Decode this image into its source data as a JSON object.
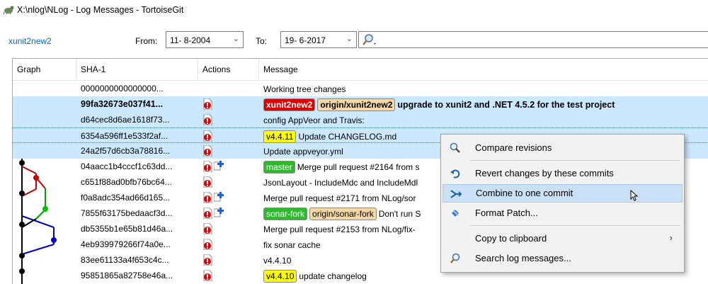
{
  "window": {
    "title": "X:\\nlog\\NLog - Log Messages - TortoiseGit"
  },
  "toolbar": {
    "branch": "xunit2new2",
    "from_label": "From:",
    "from_value": "11- 8-2004",
    "to_label": "To:",
    "to_value": "19- 6-2017"
  },
  "columns": [
    "Graph",
    "SHA-1",
    "Actions",
    "Message"
  ],
  "commits": [
    {
      "sha": "0000000000000000...",
      "message": "Working tree changes"
    },
    {
      "sha": "99fa32673e037f41...",
      "tags": [
        "xunit2new2",
        "origin/xunit2new2"
      ],
      "message": "upgrade to xunit2 and .NET 4.5.2 for the test project"
    },
    {
      "sha": "d64cec8d6ae1618f73...",
      "message": "config AppVeor and Travis:"
    },
    {
      "sha": "6354a596ff1e533f2af...",
      "tags": [
        "v4.4.11"
      ],
      "message": "Update CHANGELOG.md"
    },
    {
      "sha": "24a2f57d6cb3a78816...",
      "message": "Update appveyor.yml"
    },
    {
      "sha": "04aacc1b4cccf1c63dd...",
      "tags": [
        "master"
      ],
      "message": "Merge pull request #2164 from s"
    },
    {
      "sha": "c651f88ad0bfb76bc64...",
      "message": "JsonLayout - IncludeMdc and IncludeMdl"
    },
    {
      "sha": "f0a8adc354ad66d165...",
      "message": "Merge pull request #2171 from NLog/sor"
    },
    {
      "sha": "7855f63175bedaacf3d...",
      "tags": [
        "sonar-fork",
        "origin/sonar-fork"
      ],
      "message": "Don't run S"
    },
    {
      "sha": "db5355b1e65b81d46a...",
      "message": "Merge pull request #2153 from NLog/fix-"
    },
    {
      "sha": "4eb939979266f74a0e...",
      "message": "fix sonar cache"
    },
    {
      "sha": "83ee61133a4f653c4c...",
      "message": "v4.4.10"
    },
    {
      "sha": "95851865a82758e46a...",
      "tags": [
        "v4.4.10"
      ],
      "message": "update changelog"
    }
  ],
  "context_menu": {
    "items": [
      {
        "label": "Compare revisions",
        "icon": "magnifier-compare-icon"
      },
      {
        "label": "Revert changes by these commits",
        "icon": "revert-arrow-icon"
      },
      {
        "label": "Combine to one commit",
        "icon": "combine-arrows-icon"
      },
      {
        "label": "Format Patch...",
        "icon": "patch-icon"
      },
      {
        "label": "Copy to clipboard",
        "icon": "chevron-right-icon"
      },
      {
        "label": "Search log messages...",
        "icon": "search-icon"
      }
    ],
    "submenu_arrow": "›"
  },
  "colors": {
    "selection": "#cce8ff",
    "menu_highlight": "#c9e0f7",
    "link": "#0066cc"
  }
}
